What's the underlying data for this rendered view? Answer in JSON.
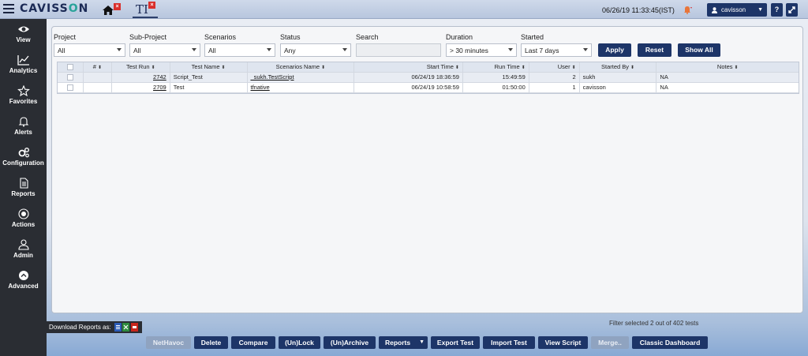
{
  "brand": {
    "name_main": "CAVISS",
    "name_accent": "O",
    "name_end": "N"
  },
  "header": {
    "tab_ti_label": "TI",
    "tab_close_glyph": "×",
    "datetime": "06/26/19 11:33:45(IST)",
    "user_name": "cavisson",
    "help_glyph": "?"
  },
  "sidebar": {
    "items": [
      {
        "label": "View",
        "icon": "eye-icon"
      },
      {
        "label": "Analytics",
        "icon": "line-chart-icon"
      },
      {
        "label": "Favorites",
        "icon": "star-icon"
      },
      {
        "label": "Alerts",
        "icon": "bell-icon"
      },
      {
        "label": "Configuration",
        "icon": "gears-icon"
      },
      {
        "label": "Reports",
        "icon": "document-icon"
      },
      {
        "label": "Actions",
        "icon": "actions-icon"
      },
      {
        "label": "Admin",
        "icon": "user-icon"
      },
      {
        "label": "Advanced",
        "icon": "chevron-up-circle-icon"
      }
    ]
  },
  "filters": {
    "project": {
      "label": "Project",
      "value": "All"
    },
    "sub_project": {
      "label": "Sub-Project",
      "value": "All"
    },
    "scenarios": {
      "label": "Scenarios",
      "value": "All"
    },
    "status": {
      "label": "Status",
      "value": "Any"
    },
    "search": {
      "label": "Search",
      "value": ""
    },
    "duration": {
      "label": "Duration",
      "value": "> 30 minutes"
    },
    "started": {
      "label": "Started",
      "value": "Last 7 days"
    },
    "apply_label": "Apply",
    "reset_label": "Reset",
    "show_all_label": "Show All"
  },
  "table": {
    "columns": [
      "#",
      "Test Run",
      "Test Name",
      "Scenarios Name",
      "Start Time",
      "Run Time",
      "User",
      "Started By",
      "Notes"
    ],
    "sort_glyph": "⬍",
    "rows": [
      {
        "num": "",
        "test_run": "2742",
        "test_name": "Script_Test",
        "scenario": "_sukh.TestScript",
        "start_time": "06/24/19 18:36:59",
        "run_time": "15:49:59",
        "user": "2",
        "started_by": "sukh",
        "notes": "NA"
      },
      {
        "num": "",
        "test_run": "2709",
        "test_name": "Test",
        "scenario": "tfnative",
        "start_time": "06/24/19 10:58:59",
        "run_time": "01:50:00",
        "user": "1",
        "started_by": "cavisson",
        "notes": "NA"
      }
    ]
  },
  "footer": {
    "download_label": "Download Reports as:",
    "filter_info": "Filter selected 2 out of 402 tests",
    "buttons": {
      "nethavoc": "NetHavoc",
      "delete": "Delete",
      "compare": "Compare",
      "unlock": "(Un)Lock",
      "unarchive": "(Un)Archive",
      "reports": "Reports",
      "export": "Export Test",
      "import": "Import Test",
      "view_script": "View Script",
      "merge": "Merge..",
      "classic_dashboard": "Classic Dashboard"
    }
  },
  "colors": {
    "primary": "#1d3568",
    "sidebar_bg": "#2a2d33",
    "alert": "#d9302c",
    "brand_accent": "#2aa39a"
  }
}
